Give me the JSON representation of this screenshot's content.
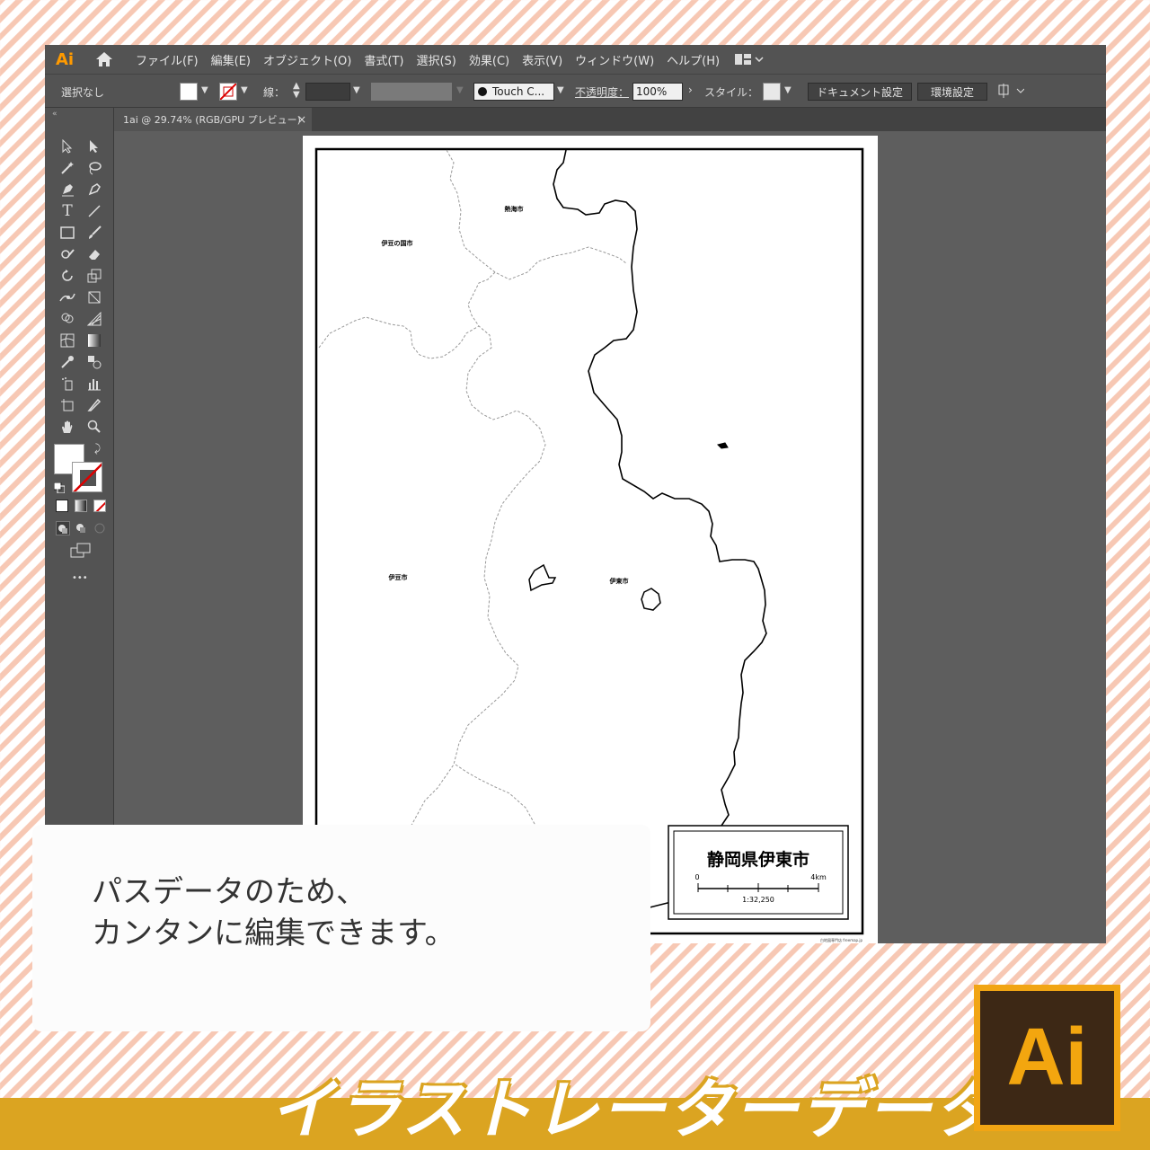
{
  "app": {
    "logo_text": "Ai"
  },
  "menu": {
    "items": [
      "ファイル(F)",
      "編集(E)",
      "オブジェクト(O)",
      "書式(T)",
      "選択(S)",
      "効果(C)",
      "表示(V)",
      "ウィンドウ(W)",
      "ヘルプ(H)"
    ]
  },
  "control_bar": {
    "selection": "選択なし",
    "stroke_label": "線：",
    "brush": "Touch C...",
    "opacity_label": "不透明度：",
    "opacity_value": "100%",
    "style_label": "スタイル：",
    "document_settings": "ドキュメント設定",
    "preferences": "環境設定"
  },
  "tab": {
    "title": "1ai @ 29.74% (RGB/GPU プレビュー)",
    "close": "×"
  },
  "toolbar": {
    "more": "•••"
  },
  "map": {
    "labels": {
      "atami": "熱海市",
      "izunokuni": "伊豆の国市",
      "izu": "伊豆市",
      "ito": "伊東市"
    },
    "title": "静岡県伊東市",
    "scale_start": "0",
    "scale_end": "4km",
    "scale_ratio": "1:32,250",
    "credit": "白地図専門店 freemap.jp"
  },
  "caption": {
    "text": "パスデータのため、\nカンタンに編集できます。"
  },
  "footer": {
    "text": "イラストレーターデータ"
  },
  "badge": {
    "text": "Ai"
  },
  "colors": {
    "ui_bg": "#535353",
    "canvas": "#5e5e5e",
    "accent": "#dba421",
    "ai_orange": "#f1a514",
    "ai_brown": "#3d2815"
  }
}
